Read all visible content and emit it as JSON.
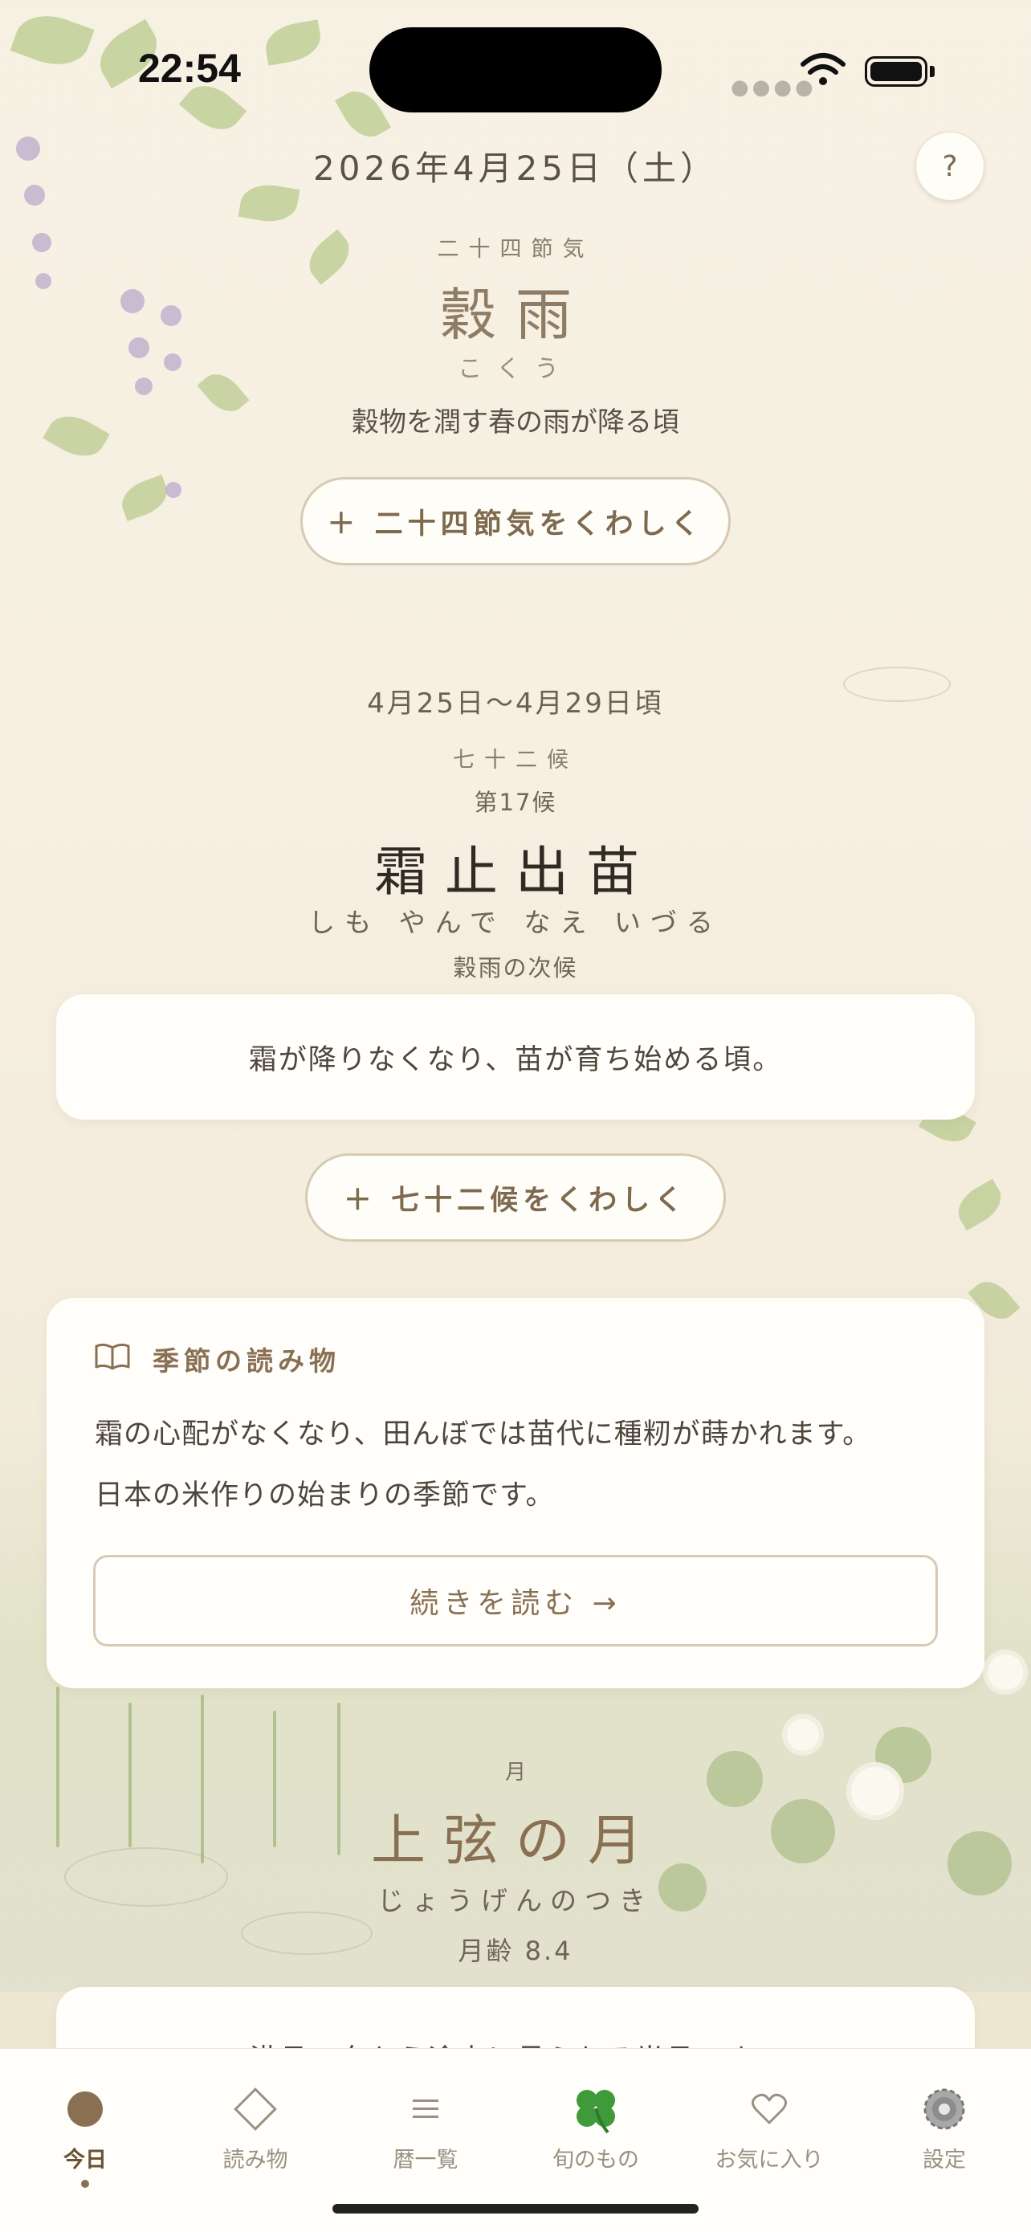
{
  "status_bar": {
    "time": "22:54"
  },
  "header": {
    "date": "2026年4月25日（土）",
    "help_label": "?"
  },
  "sekki": {
    "kicker": "二十四節気",
    "name": "穀雨",
    "reading": "こくう",
    "description": "穀物を潤す春の雨が降る頃",
    "detail_button": "＋ 二十四節気をくわしく"
  },
  "ko": {
    "date_range": "4月25日〜4月29日頃",
    "kicker": "七十二候",
    "number": "第17候",
    "name": "霜止出苗",
    "reading": "しも やんで なえ いづる",
    "relation": "穀雨の次候",
    "description": "霜が降りなくなり、苗が育ち始める頃。",
    "detail_button": "＋ 七十二候をくわしく"
  },
  "reading_card": {
    "icon": "book-icon",
    "title": "季節の読み物",
    "body_line1": "霜の心配がなくなり、田んぼでは苗代に種籾が蒔かれます。",
    "body_line2": "日本の米作りの始まりの季節です。",
    "continue_button": "続きを読む →"
  },
  "moon": {
    "kicker": "月",
    "name": "上弦の月",
    "reading": "じょうげんのつき",
    "age": "月齢 8.4",
    "description_partial": "満月へ向かう途中に見られる半月です。"
  },
  "tabs": [
    {
      "label": "今日",
      "icon": "today-dot-icon",
      "active": true
    },
    {
      "label": "読み物",
      "icon": "diamond-icon",
      "active": false
    },
    {
      "label": "暦一覧",
      "icon": "list-icon",
      "active": false
    },
    {
      "label": "旬のもの",
      "icon": "clover-icon",
      "active": false
    },
    {
      "label": "お気に入り",
      "icon": "heart-icon",
      "active": false
    },
    {
      "label": "設定",
      "icon": "gear-icon",
      "active": false
    }
  ],
  "colors": {
    "accent": "#8a7053",
    "background": "#f6efe2",
    "card": "#fffefb",
    "clover_green": "#3f9a3a"
  }
}
